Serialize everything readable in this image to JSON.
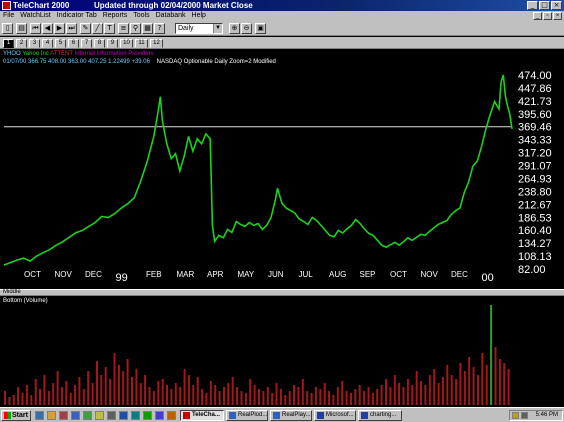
{
  "window": {
    "app_title": "TeleChart 2000",
    "status_title": "Updated through 02/04/2000 Market Close"
  },
  "menu": [
    "File",
    "WatchList",
    "Indicator Tab",
    "Reports",
    "Tools",
    "Databank",
    "Help"
  ],
  "toolbar": {
    "symbol_value": "",
    "period_value": "Daily"
  },
  "tabs": [
    "1",
    "2",
    "3",
    "4",
    "5",
    "6",
    "7",
    "8",
    "9",
    "10",
    "11",
    "12"
  ],
  "info": {
    "symbol": "YHOO",
    "company": "Yahoo Inc",
    "ticker_alt": "ATTENT",
    "note": "Internet Information Providers",
    "quote_line": "01/07/00  366.75  408.00  363.00  407.25  1.22499  +39.06",
    "status_line": "NASDAQ  Optionable  Daily  Zoom=2  Modified"
  },
  "colors": {
    "price_line": "#1ad31a",
    "volume_bars": "#a31818",
    "axis_text": "#ffffff",
    "hline": "#e0e0e0"
  },
  "chart_data": {
    "type": "line",
    "y_ticks": [
      "474.00",
      "447.86",
      "421.73",
      "395.60",
      "369.46",
      "343.33",
      "317.20",
      "291.07",
      "264.93",
      "238.80",
      "212.67",
      "186.53",
      "160.40",
      "134.27",
      "108.13",
      "82.00"
    ],
    "ylim": [
      82,
      474
    ],
    "x_labels": [
      "OCT",
      "NOV",
      "DEC",
      "99",
      "FEB",
      "MAR",
      "APR",
      "MAY",
      "JUN",
      "JUL",
      "AUG",
      "SEP",
      "OCT",
      "NOV",
      "DEC",
      "00"
    ],
    "horizontal_line_value": 369.46,
    "price_points": [
      [
        0,
        90
      ],
      [
        3,
        95
      ],
      [
        6,
        100
      ],
      [
        9,
        104
      ],
      [
        12,
        98
      ],
      [
        15,
        108
      ],
      [
        18,
        115
      ],
      [
        21,
        121
      ],
      [
        24,
        130
      ],
      [
        27,
        137
      ],
      [
        30,
        146
      ],
      [
        33,
        155
      ],
      [
        36,
        160
      ],
      [
        39,
        168
      ],
      [
        42,
        176
      ],
      [
        45,
        188
      ],
      [
        48,
        186
      ],
      [
        51,
        194
      ],
      [
        54,
        205
      ],
      [
        57,
        214
      ],
      [
        60,
        226
      ],
      [
        63,
        260
      ],
      [
        66,
        300
      ],
      [
        69,
        350
      ],
      [
        71,
        400
      ],
      [
        72,
        430
      ],
      [
        73,
        380
      ],
      [
        75,
        335
      ],
      [
        77,
        305
      ],
      [
        79,
        315
      ],
      [
        81,
        280
      ],
      [
        83,
        310
      ],
      [
        85,
        350
      ],
      [
        87,
        320
      ],
      [
        89,
        345
      ],
      [
        91,
        335
      ],
      [
        93,
        355
      ],
      [
        95,
        345
      ],
      [
        96,
        170
      ],
      [
        97,
        138
      ],
      [
        99,
        150
      ],
      [
        101,
        145
      ],
      [
        103,
        162
      ],
      [
        105,
        156
      ],
      [
        107,
        178
      ],
      [
        109,
        172
      ],
      [
        111,
        168
      ],
      [
        113,
        176
      ],
      [
        115,
        170
      ],
      [
        117,
        174
      ],
      [
        119,
        162
      ],
      [
        121,
        170
      ],
      [
        123,
        186
      ],
      [
        125,
        222
      ],
      [
        126,
        245
      ],
      [
        128,
        215
      ],
      [
        130,
        205
      ],
      [
        132,
        200
      ],
      [
        134,
        195
      ],
      [
        136,
        183
      ],
      [
        138,
        178
      ],
      [
        140,
        172
      ],
      [
        142,
        186
      ],
      [
        144,
        180
      ],
      [
        146,
        170
      ],
      [
        148,
        160
      ],
      [
        150,
        150
      ],
      [
        152,
        147
      ],
      [
        154,
        160
      ],
      [
        156,
        155
      ],
      [
        158,
        163
      ],
      [
        160,
        170
      ],
      [
        162,
        182
      ],
      [
        164,
        174
      ],
      [
        166,
        163
      ],
      [
        168,
        154
      ],
      [
        170,
        150
      ],
      [
        172,
        140
      ],
      [
        174,
        130
      ],
      [
        176,
        126
      ],
      [
        178,
        131
      ],
      [
        180,
        136
      ],
      [
        182,
        130
      ],
      [
        184,
        137
      ],
      [
        186,
        145
      ],
      [
        188,
        140
      ],
      [
        190,
        146
      ],
      [
        192,
        152
      ],
      [
        194,
        150
      ],
      [
        196,
        158
      ],
      [
        198,
        165
      ],
      [
        200,
        172
      ],
      [
        202,
        176
      ],
      [
        204,
        180
      ],
      [
        206,
        192
      ],
      [
        208,
        200
      ],
      [
        210,
        205
      ],
      [
        212,
        236
      ],
      [
        214,
        258
      ],
      [
        216,
        290
      ],
      [
        218,
        300
      ],
      [
        220,
        330
      ],
      [
        222,
        365
      ],
      [
        224,
        395
      ],
      [
        226,
        420
      ],
      [
        228,
        405
      ],
      [
        229,
        460
      ],
      [
        230,
        474
      ],
      [
        231,
        430
      ],
      [
        232,
        410
      ],
      [
        233,
        395
      ],
      [
        234,
        365
      ]
    ],
    "volume_values": [
      14,
      8,
      10,
      18,
      12,
      20,
      10,
      26,
      16,
      30,
      14,
      22,
      34,
      18,
      24,
      12,
      20,
      28,
      16,
      34,
      22,
      44,
      30,
      38,
      26,
      52,
      40,
      34,
      46,
      28,
      36,
      22,
      30,
      18,
      14,
      24,
      26,
      20,
      16,
      22,
      18,
      36,
      30,
      20,
      28,
      16,
      12,
      24,
      20,
      14,
      18,
      22,
      28,
      18,
      14,
      12,
      26,
      20,
      16,
      14,
      18,
      12,
      22,
      16,
      10,
      14,
      20,
      18,
      26,
      14,
      12,
      18,
      16,
      22,
      14,
      10,
      18,
      24,
      14,
      12,
      16,
      20,
      14,
      18,
      12,
      16,
      20,
      26,
      18,
      30,
      22,
      18,
      26,
      20,
      34,
      24,
      20,
      30,
      36,
      22,
      28,
      40,
      30,
      26,
      42,
      34,
      48,
      38,
      30,
      52,
      40,
      100,
      58,
      46,
      42,
      36
    ]
  },
  "volume_label": "Bottom (Volume)",
  "middle_label": "Middle",
  "taskbar": {
    "start_label": "Start",
    "tasks": [
      "TeleCha...",
      "RealPlod...",
      "RealPlay...",
      "Microsof...",
      "charting..."
    ],
    "clock": "5:46 PM"
  }
}
